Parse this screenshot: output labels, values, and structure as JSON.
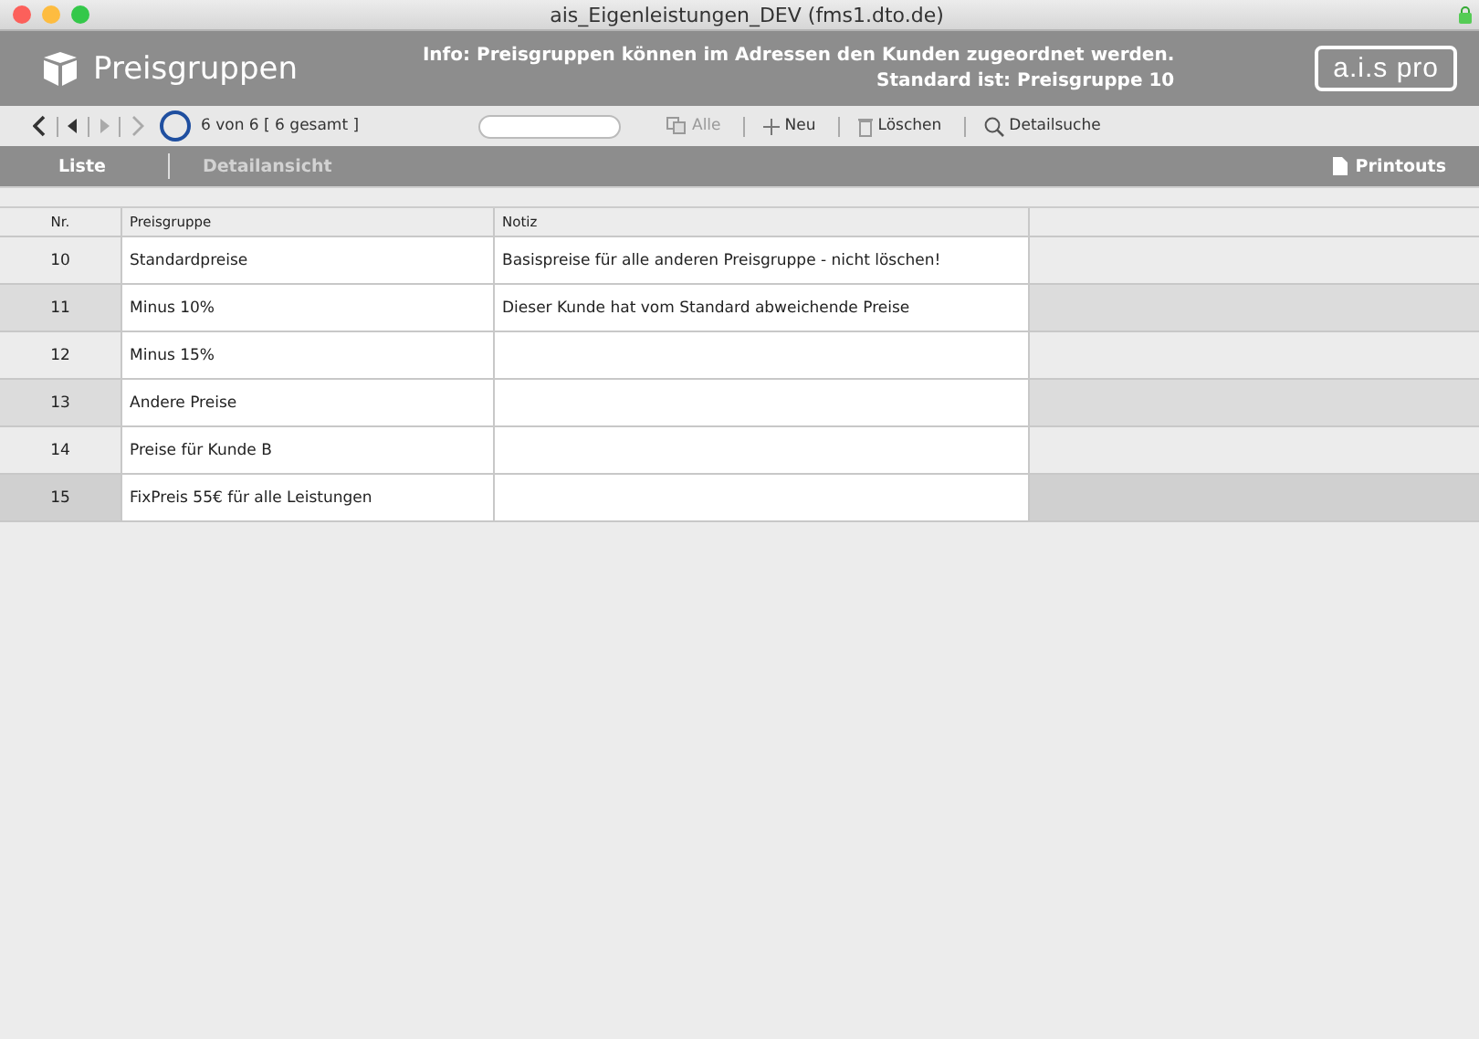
{
  "window": {
    "title": "ais_Eigenleistungen_DEV (fms1.dto.de)"
  },
  "header": {
    "title": "Preisgruppen",
    "info": [
      "Info: Preisgruppen können im Adressen den Kunden zugeordnet werden.",
      "Standard ist: Preisgruppe 10"
    ],
    "logo": "a.i.s pro"
  },
  "toolbar": {
    "record_count": "6 von 6  [ 6 gesamt ]",
    "buttons": [
      {
        "kind": "all",
        "label": "Alle",
        "disabled": true
      },
      {
        "kind": "new",
        "label": "Neu",
        "disabled": false
      },
      {
        "kind": "delete",
        "label": "Löschen",
        "disabled": false
      },
      {
        "kind": "search",
        "label": "Detailsuche",
        "disabled": false
      }
    ]
  },
  "tabs": [
    {
      "label": "Liste",
      "selected": true
    },
    {
      "label": "Detailansicht",
      "selected": false
    }
  ],
  "printouts": "Printouts",
  "table": {
    "columns": [
      "Nr.",
      "Preisgruppe",
      "Notiz"
    ],
    "rows": [
      {
        "cells": [
          "10",
          "Standardpreise",
          "Basispreise  für alle anderen Preisgruppe - nicht löschen!"
        ],
        "selected": false
      },
      {
        "cells": [
          "11",
          " Minus 10%",
          "Dieser Kunde hat vom Standard abweichende Preise"
        ],
        "selected": false
      },
      {
        "cells": [
          "12",
          "Minus 15%",
          ""
        ],
        "selected": false
      },
      {
        "cells": [
          "13",
          "Andere Preise",
          ""
        ],
        "selected": false
      },
      {
        "cells": [
          "14",
          "Preise für Kunde B",
          ""
        ],
        "selected": false
      },
      {
        "cells": [
          "15",
          "FixPreis  55€ für alle Leistungen",
          ""
        ],
        "selected": true
      }
    ]
  }
}
